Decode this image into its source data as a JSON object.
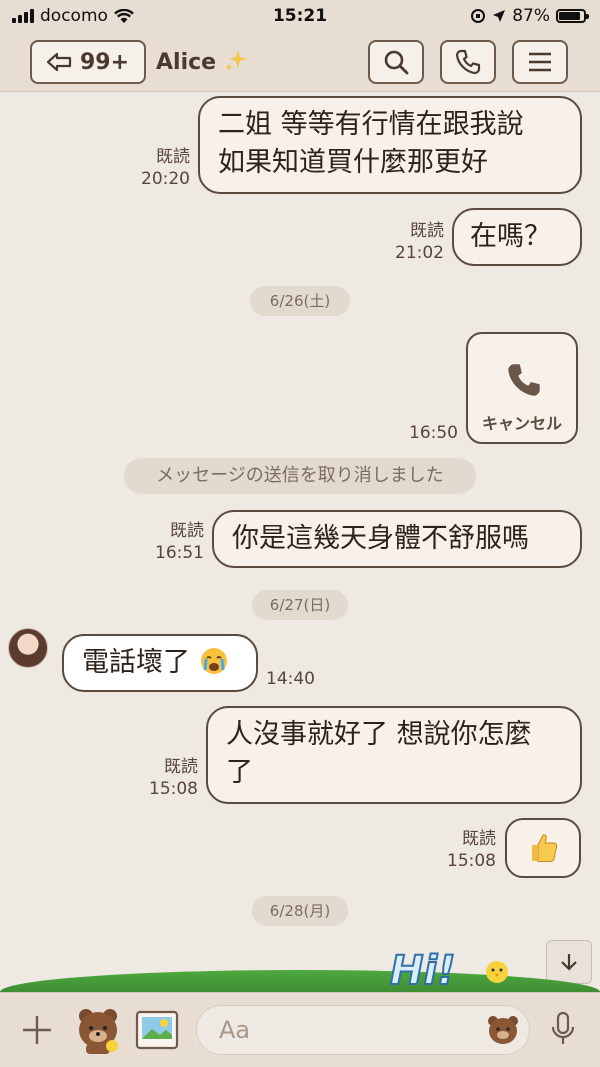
{
  "status_bar": {
    "carrier": "docomo",
    "time": "15:21",
    "battery": "87%",
    "battery_level": 0.87
  },
  "header": {
    "back_count": "99+",
    "contact_name": "Alice",
    "icons": [
      "back-arrow-icon",
      "sparkles-icon",
      "search-icon",
      "phone-icon",
      "menu-icon"
    ]
  },
  "messages": {
    "m1": {
      "read": "既読",
      "time": "20:20",
      "line1": "二姐 等等有行情在跟我說",
      "line2": "如果知道買什麼那更好"
    },
    "m2": {
      "read": "既読",
      "time": "21:02",
      "text": "在嗎？"
    },
    "date1": "6/26(土)",
    "m3": {
      "time": "16:50",
      "label": "キャンセル"
    },
    "system": "メッセージの送信を取り消しました",
    "m4": {
      "read": "既読",
      "time": "16:51",
      "text": "你是這幾天身體不舒服嗎"
    },
    "date2": "6/27(日)",
    "m5": {
      "time": "14:40",
      "text": "電話壞了"
    },
    "m6": {
      "read": "既読",
      "time": "15:08",
      "line1": "人沒事就好了 想說你怎麼",
      "line2": "了"
    },
    "m7": {
      "read": "既読",
      "time": "15:08"
    },
    "date3": "6/28(月)"
  },
  "banner": {
    "text": "Hi!"
  },
  "input": {
    "placeholder": "Aa"
  },
  "colors": {
    "bubble_border": "#5b4a3e",
    "background": "#efe9e3",
    "bar": "#e7ddd2",
    "grass": "#4ea93f"
  }
}
